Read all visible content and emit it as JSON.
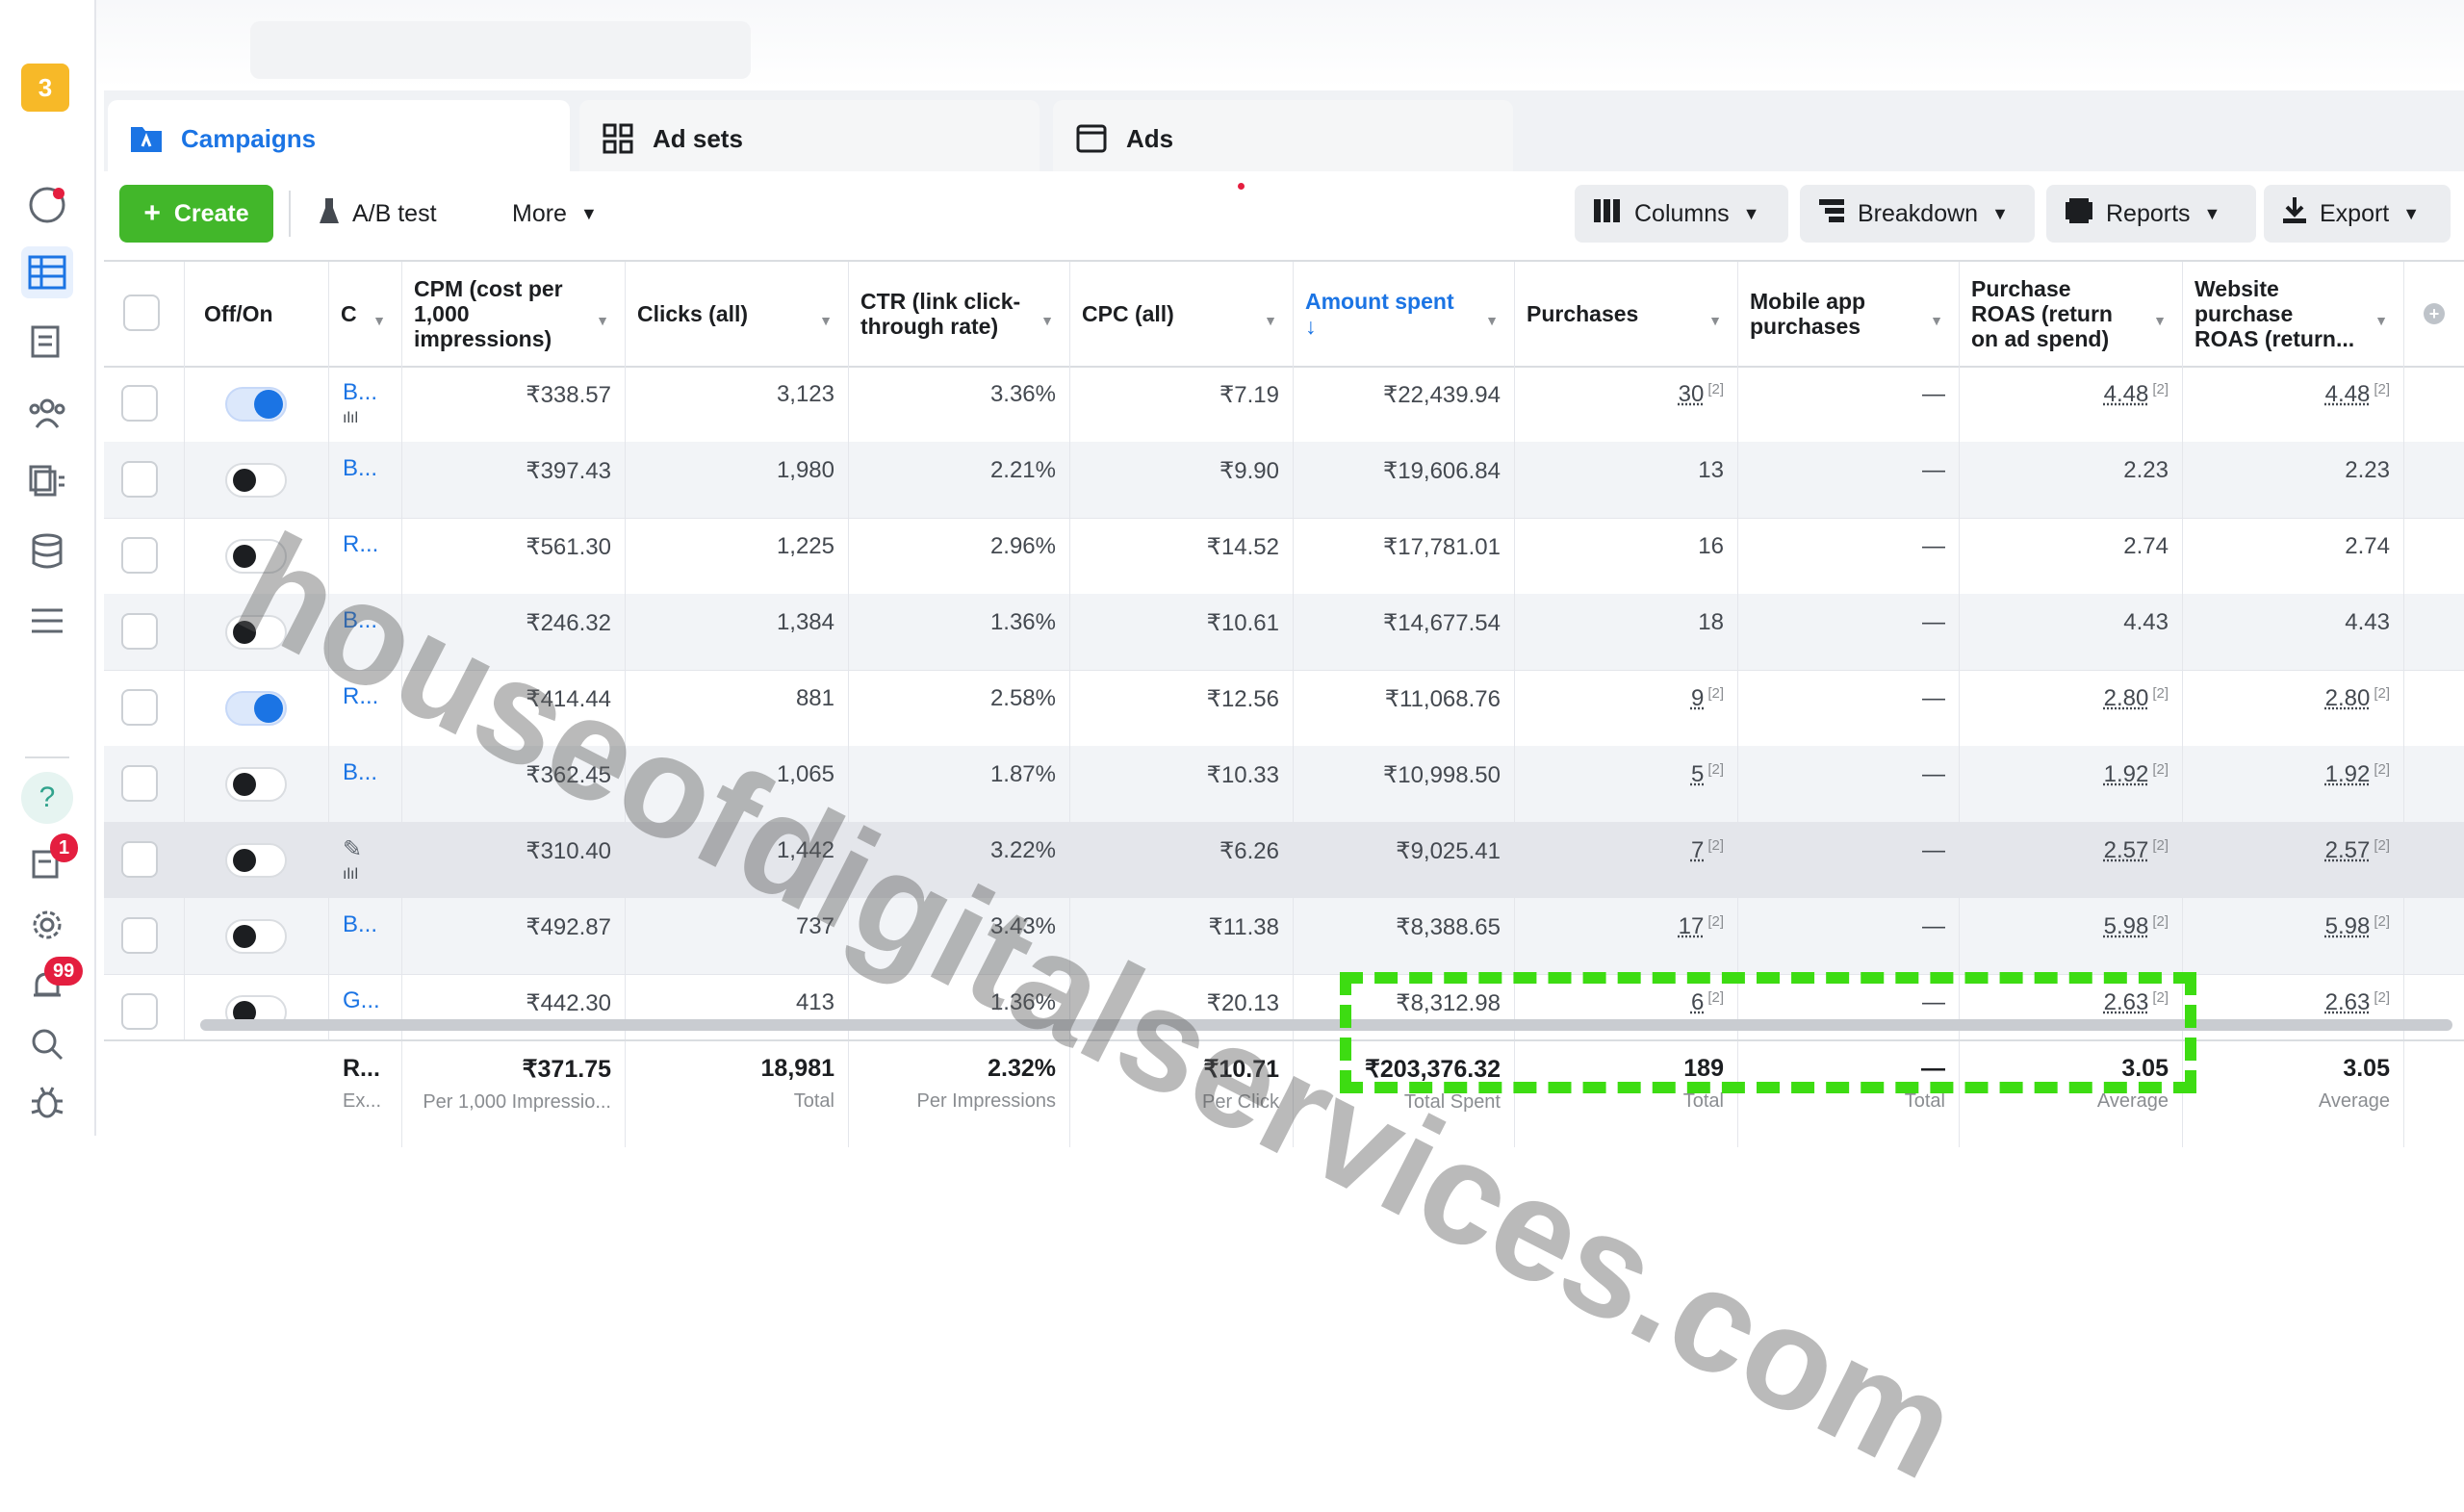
{
  "watermark": "houseofdigitalservices.com",
  "account_badge": "3",
  "tabs": [
    {
      "label": "Campaigns",
      "icon": "folder-icon"
    },
    {
      "label": "Ad sets",
      "icon": "grid-icon"
    },
    {
      "label": "Ads",
      "icon": "ad-window-icon"
    }
  ],
  "toolbar": {
    "create": "Create",
    "ab_test": "A/B test",
    "more": "More",
    "columns": "Columns",
    "breakdown": "Breakdown",
    "reports": "Reports",
    "export": "Export"
  },
  "sidebar": {
    "notifications_badge": "1",
    "alerts_badge": "99",
    "help": "?"
  },
  "columns": {
    "offon": "Off/On",
    "name": "C",
    "cpm": "CPM (cost per 1,000 impressions)",
    "clicks": "Clicks (all)",
    "ctr": "CTR (link click-through rate)",
    "cpc": "CPC (all)",
    "amount": "Amount spent",
    "amount_sort": "↓",
    "purchases": "Purchases",
    "mobile": "Mobile app purchases",
    "roas": "Purchase ROAS (return on ad spend)",
    "web_roas": "Website purchase ROAS (return..."
  },
  "rows": [
    {
      "name": "B...",
      "on": true,
      "cpm": "₹338.57",
      "clicks": "3,123",
      "ctr": "3.36%",
      "cpc": "₹7.19",
      "amount": "₹22,439.94",
      "purchases": "30",
      "mobile": "—",
      "roas": "4.48",
      "web_roas": "4.48",
      "sup": "[2]",
      "marker": "ılıl"
    },
    {
      "name": "B...",
      "on": false,
      "cpm": "₹397.43",
      "clicks": "1,980",
      "ctr": "2.21%",
      "cpc": "₹9.90",
      "amount": "₹19,606.84",
      "purchases": "13",
      "mobile": "—",
      "roas": "2.23",
      "web_roas": "2.23",
      "sup": "",
      "marker": ""
    },
    {
      "name": "R...",
      "on": false,
      "cpm": "₹561.30",
      "clicks": "1,225",
      "ctr": "2.96%",
      "cpc": "₹14.52",
      "amount": "₹17,781.01",
      "purchases": "16",
      "mobile": "—",
      "roas": "2.74",
      "web_roas": "2.74",
      "sup": "",
      "marker": ""
    },
    {
      "name": "B...",
      "on": false,
      "cpm": "₹246.32",
      "clicks": "1,384",
      "ctr": "1.36%",
      "cpc": "₹10.61",
      "amount": "₹14,677.54",
      "purchases": "18",
      "mobile": "—",
      "roas": "4.43",
      "web_roas": "4.43",
      "sup": "",
      "marker": ""
    },
    {
      "name": "R...",
      "on": true,
      "cpm": "₹414.44",
      "clicks": "881",
      "ctr": "2.58%",
      "cpc": "₹12.56",
      "amount": "₹11,068.76",
      "purchases": "9",
      "mobile": "—",
      "roas": "2.80",
      "web_roas": "2.80",
      "sup": "[2]",
      "marker": ""
    },
    {
      "name": "B...",
      "on": false,
      "cpm": "₹362.45",
      "clicks": "1,065",
      "ctr": "1.87%",
      "cpc": "₹10.33",
      "amount": "₹10,998.50",
      "purchases": "5",
      "mobile": "—",
      "roas": "1.92",
      "web_roas": "1.92",
      "sup": "[2]",
      "marker": ""
    },
    {
      "name": "✎",
      "on": false,
      "cpm": "₹310.40",
      "clicks": "1,442",
      "ctr": "3.22%",
      "cpc": "₹6.26",
      "amount": "₹9,025.41",
      "purchases": "7",
      "mobile": "—",
      "roas": "2.57",
      "web_roas": "2.57",
      "sup": "[2]",
      "marker": "ılıl"
    },
    {
      "name": "B...",
      "on": false,
      "cpm": "₹492.87",
      "clicks": "737",
      "ctr": "3.43%",
      "cpc": "₹11.38",
      "amount": "₹8,388.65",
      "purchases": "17",
      "mobile": "—",
      "roas": "5.98",
      "web_roas": "5.98",
      "sup": "[2]",
      "marker": ""
    },
    {
      "name": "G...",
      "on": false,
      "cpm": "₹442.30",
      "clicks": "413",
      "ctr": "1.36%",
      "cpc": "₹20.13",
      "amount": "₹8,312.98",
      "purchases": "6",
      "mobile": "—",
      "roas": "2.63",
      "web_roas": "2.63",
      "sup": "[2]",
      "marker": ""
    }
  ],
  "totals": {
    "name": "R...",
    "name_sub": "Ex...",
    "cpm": "₹371.75",
    "cpm_sub": "Per 1,000 Impressio...",
    "clicks": "18,981",
    "clicks_sub": "Total",
    "ctr": "2.32%",
    "ctr_sub": "Per Impressions",
    "cpc": "₹10.71",
    "cpc_sub": "Per Click",
    "amount": "₹203,376.32",
    "amount_sub": "Total Spent",
    "purchases": "189",
    "purchases_sub": "Total",
    "mobile": "—",
    "mobile_sub": "Total",
    "roas": "3.05",
    "roas_sub": "Average",
    "web_roas": "3.05",
    "web_roas_sub": "Average"
  },
  "colors": {
    "accent": "#1b74e4",
    "create": "#42b72a",
    "callout": "#3ddc12",
    "badge": "#e41e3f"
  }
}
